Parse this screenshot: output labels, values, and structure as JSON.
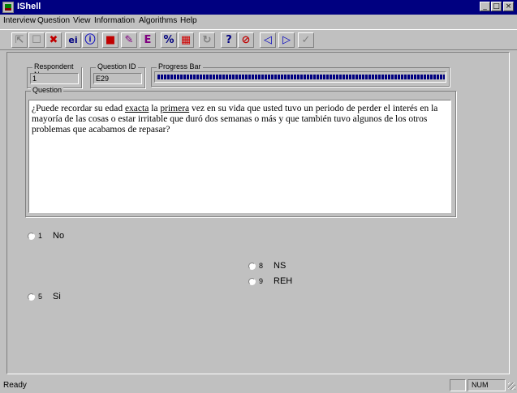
{
  "window": {
    "title": "IShell"
  },
  "menu": [
    "Interview",
    "Question",
    "View",
    "Information",
    "Algorithms",
    "Help"
  ],
  "toolbar": {
    "buttons": [
      {
        "name": "respondent-icon",
        "glyph": "⇱"
      },
      {
        "name": "select-icon",
        "glyph": "☐"
      },
      {
        "name": "cancel-x-icon",
        "glyph": "✖"
      },
      {
        "name": "ei-icon",
        "glyph": "ei"
      },
      {
        "name": "info-icon",
        "glyph": "ⓘ"
      },
      {
        "name": "record-icon",
        "glyph": "■"
      },
      {
        "name": "edit-icon",
        "glyph": "✎"
      },
      {
        "name": "chart-icon",
        "glyph": "E"
      },
      {
        "name": "percent-icon",
        "glyph": "%"
      },
      {
        "name": "palette-icon",
        "glyph": "▦"
      },
      {
        "name": "refresh-icon",
        "glyph": "↻"
      },
      {
        "name": "help-icon",
        "glyph": "?"
      },
      {
        "name": "stop-icon",
        "glyph": "⊘"
      },
      {
        "name": "previous-icon",
        "glyph": "◁"
      },
      {
        "name": "next-icon",
        "glyph": "▷"
      },
      {
        "name": "checkmark-icon",
        "glyph": "✓"
      }
    ]
  },
  "respondent": {
    "label": "Respondent No",
    "value": "1"
  },
  "question_id": {
    "label": "Question ID",
    "value": "E29"
  },
  "progress": {
    "label": "Progress Bar",
    "fraction": 1.0
  },
  "question": {
    "label": "Question",
    "parts": [
      {
        "text": "¿Puede recordar su edad ",
        "underline": false
      },
      {
        "text": "exacta",
        "underline": true
      },
      {
        "text": " la ",
        "underline": false
      },
      {
        "text": "primera",
        "underline": true
      },
      {
        "text": " vez en su vida que usted tuvo un periodo de perder el interés en la mayoría de las cosas o estar irritable que duró dos semanas o más y que también tuvo algunos de los otros problemas que acabamos de repasar?",
        "underline": false
      }
    ]
  },
  "options": [
    {
      "code": "1",
      "label": "No"
    },
    {
      "code": "5",
      "label": "Si"
    },
    {
      "code": "8",
      "label": "NS"
    },
    {
      "code": "9",
      "label": "REH"
    }
  ],
  "status": {
    "text": "Ready",
    "num": "NUM"
  }
}
